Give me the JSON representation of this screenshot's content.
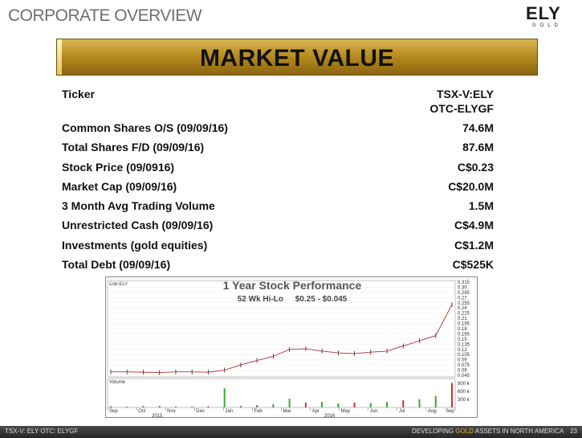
{
  "header": {
    "title": "CORPORATE OVERVIEW",
    "logo_mark": "ELY",
    "logo_sub": "GOLD"
  },
  "banner": {
    "title": "MARKET VALUE"
  },
  "rows": [
    {
      "label": "Ticker",
      "values": [
        "TSX-V:ELY",
        "OTC-ELYGF"
      ]
    },
    {
      "label": "Common Shares O/S (09/09/16)",
      "values": [
        "74.6M"
      ]
    },
    {
      "label": "Total Shares F/D (09/09/16)",
      "values": [
        "87.6M"
      ]
    },
    {
      "label": "Stock Price (09/0916)",
      "values": [
        "C$0.23"
      ]
    },
    {
      "label": "Market Cap (09/09/16)",
      "values": [
        "C$20.0M"
      ]
    },
    {
      "label": "3 Month Avg Trading Volume",
      "values": [
        "1.5M"
      ]
    },
    {
      "label": "Unrestricted Cash (09/09/16)",
      "values": [
        "C$4.9M"
      ]
    },
    {
      "label": "Investments (gold equities)",
      "values": [
        "C$1.2M"
      ]
    },
    {
      "label": "Total Debt (09/09/16)",
      "values": [
        "C$525K"
      ]
    }
  ],
  "chart_data": {
    "type": "line",
    "symbol": "Cdv:ELY",
    "title": "1 Year Stock Performance",
    "subtitle_label": "52 Wk Hi-Lo",
    "subtitle_value": "$0.25 - $0.045",
    "price_ticks": [
      "0.315",
      "0.30",
      "0.285",
      "0.27",
      "0.255",
      "0.24",
      "0.225",
      "0.21",
      "0.195",
      "0.18",
      "0.165",
      "0.15",
      "0.135",
      "0.12",
      "0.105",
      "0.09",
      "0.075",
      "0.06",
      "0.045"
    ],
    "ylim": [
      0.045,
      0.315
    ],
    "volume_label": "Volume",
    "volume_ticks": [
      "900 k",
      "600 k",
      "300 k"
    ],
    "months": [
      "Sep",
      "Oct",
      "Nov",
      "Dec",
      "Jan",
      "Feb",
      "Mar",
      "Apr",
      "May",
      "Jun",
      "Jul",
      "Aug",
      "Sep"
    ],
    "years": [
      "2015",
      "2016"
    ],
    "price": [
      0.055,
      0.055,
      0.054,
      0.053,
      0.055,
      0.055,
      0.054,
      0.06,
      0.075,
      0.088,
      0.1,
      0.12,
      0.122,
      0.115,
      0.11,
      0.108,
      0.112,
      0.115,
      0.13,
      0.145,
      0.16,
      0.25
    ],
    "volume": [
      40,
      30,
      60,
      50,
      40,
      35,
      45,
      700,
      60,
      80,
      120,
      320,
      180,
      200,
      150,
      180,
      160,
      200,
      260,
      300,
      420,
      900
    ]
  },
  "footer": {
    "left": "TSX-V: ELY  OTC: ELYGF",
    "right_pre": "DEVELOPING ",
    "right_gold": "GOLD",
    "right_post": " ASSETS IN NORTH AMERICA",
    "page": "23"
  }
}
